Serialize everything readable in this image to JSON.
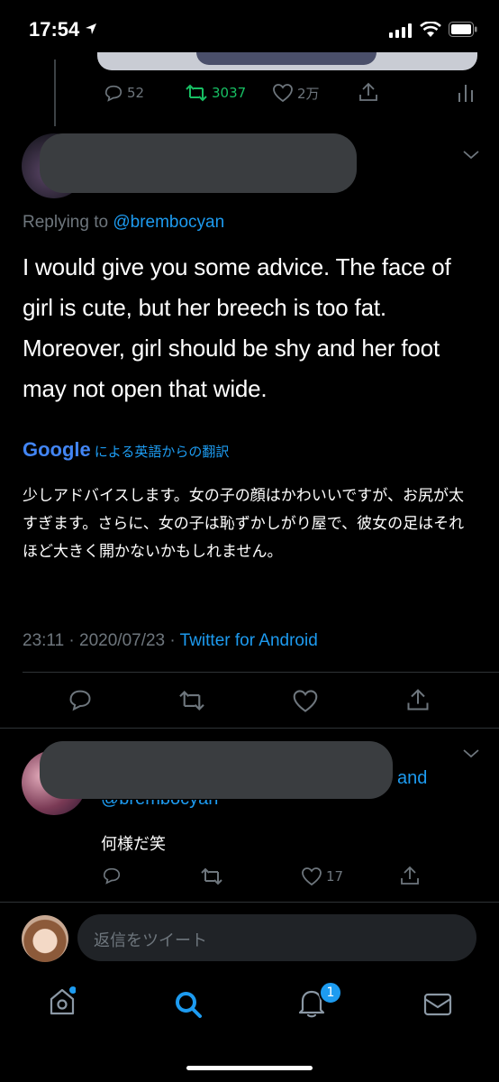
{
  "status_bar": {
    "time": "17:54"
  },
  "prev_tweet": {
    "replies": "52",
    "retweets": "3037",
    "likes": "2万"
  },
  "main_tweet": {
    "replying_prefix": "Replying to ",
    "replying_handle": "@brembocyan",
    "text": "I would give you some advice. The face of girl is cute, but her breech is too fat. Moreover, girl should be shy and her foot may not open that wide.",
    "translation_brand": "Google",
    "translation_label": "による英語からの翻訳",
    "translation_text": "少しアドバイスします。女の子の顔はかわいいですが、お尻が太すぎます。さらに、女の子は恥ずかしがり屋で、彼女の足はそれほど大きく開かないかもしれません。",
    "timestamp": "23:11 · 2020/07/23 · ",
    "source": "Twitter for Android"
  },
  "reply_tweet": {
    "and_text": "and",
    "handle_partial": "@brembocyan",
    "text": "何様だ笑",
    "likes": "17"
  },
  "composer": {
    "placeholder": "返信をツイート"
  },
  "tab_bar": {
    "notification_count": "1"
  },
  "colors": {
    "accent": "#1d9bf0",
    "retweet": "#17bf63",
    "background": "#000000",
    "divider": "#2f3336"
  }
}
